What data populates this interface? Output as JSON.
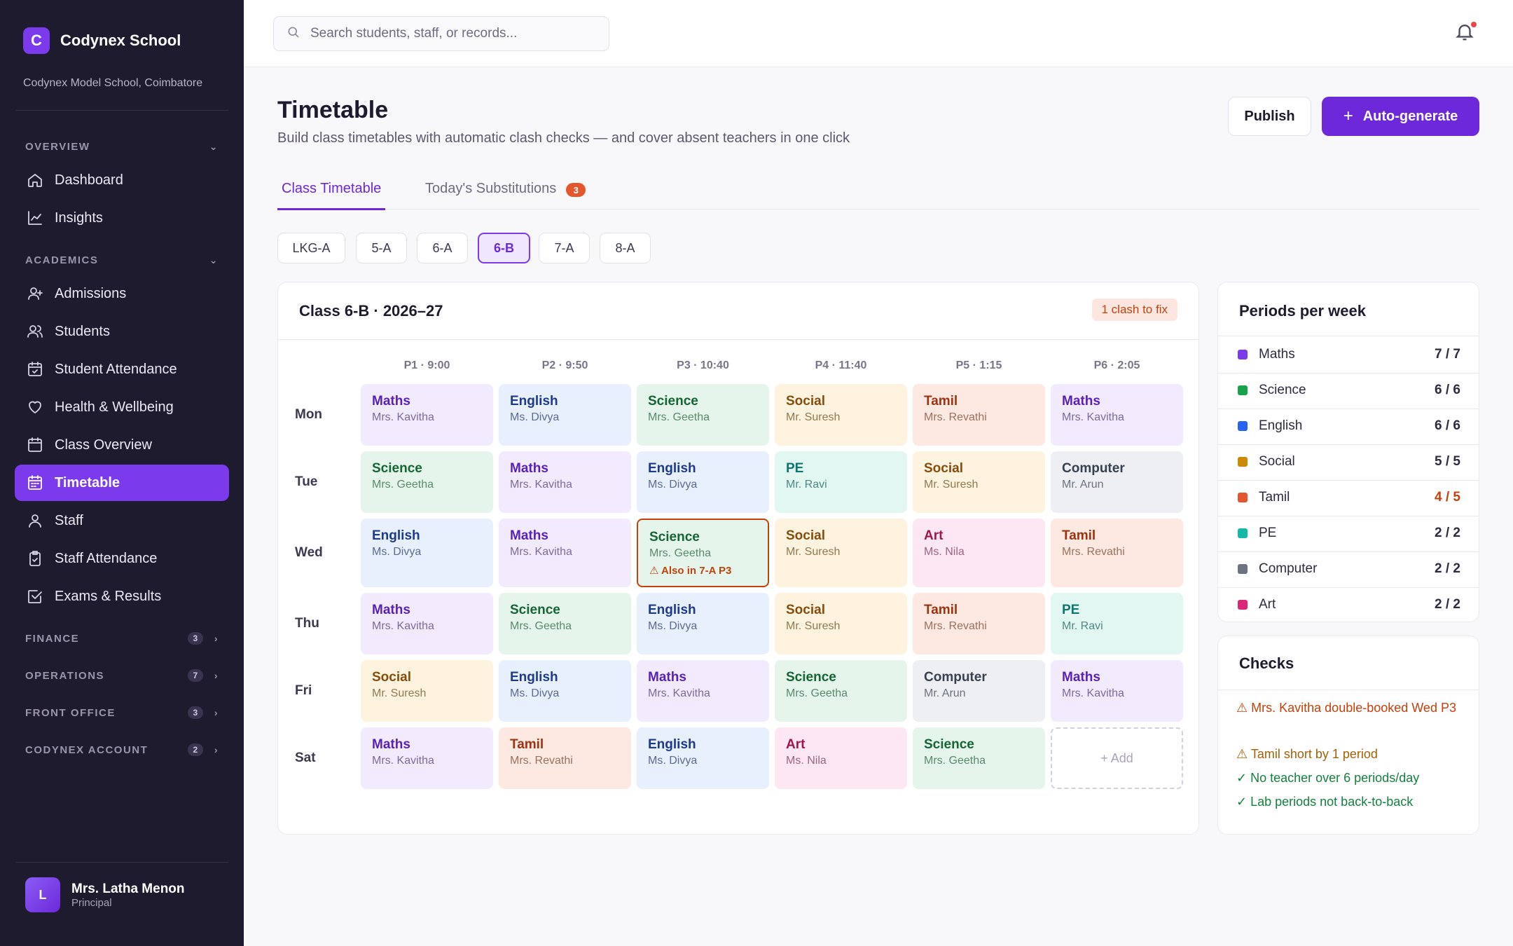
{
  "brand": {
    "logo_letter": "C",
    "name": "Codynex School",
    "school": "Codynex Model School, Coimbatore"
  },
  "sidebar": {
    "overview": {
      "label": "OVERVIEW",
      "items": [
        {
          "label": "Dashboard",
          "icon": "home-icon"
        },
        {
          "label": "Insights",
          "icon": "chart-line-icon"
        }
      ]
    },
    "academics": {
      "label": "ACADEMICS",
      "items": [
        {
          "label": "Admissions",
          "icon": "user-plus-icon"
        },
        {
          "label": "Students",
          "icon": "users-icon"
        },
        {
          "label": "Student Attendance",
          "icon": "calendar-check-icon"
        },
        {
          "label": "Health & Wellbeing",
          "icon": "heart-icon"
        },
        {
          "label": "Class Overview",
          "icon": "calendar-icon"
        },
        {
          "label": "Timetable",
          "icon": "calendar-grid-icon",
          "active": true
        },
        {
          "label": "Staff",
          "icon": "user-icon"
        },
        {
          "label": "Staff Attendance",
          "icon": "clipboard-check-icon"
        },
        {
          "label": "Exams & Results",
          "icon": "checkbox-icon"
        }
      ]
    },
    "collapsed": [
      {
        "label": "FINANCE",
        "count": "3"
      },
      {
        "label": "OPERATIONS",
        "count": "7"
      },
      {
        "label": "FRONT OFFICE",
        "count": "3"
      },
      {
        "label": "CODYNEX ACCOUNT",
        "count": "2"
      }
    ],
    "user": {
      "initial": "L",
      "name": "Mrs. Latha Menon",
      "role": "Principal"
    }
  },
  "topbar": {
    "search_placeholder": "Search students, staff, or records..."
  },
  "header": {
    "title": "Timetable",
    "subtitle": "Build class timetables with automatic clash checks — and cover absent teachers in one click",
    "publish_label": "Publish",
    "auto_label": "Auto-generate"
  },
  "tabs": [
    {
      "label": "Class Timetable",
      "active": true
    },
    {
      "label": "Today's Substitutions",
      "badge": "3"
    }
  ],
  "classes": [
    {
      "label": "LKG-A"
    },
    {
      "label": "5-A"
    },
    {
      "label": "6-A"
    },
    {
      "label": "6-B",
      "active": true
    },
    {
      "label": "7-A"
    },
    {
      "label": "8-A"
    }
  ],
  "timetable": {
    "title": "Class 6-B · 2026–27",
    "clash_label": "1 clash to fix",
    "periods": [
      "P1 · 9:00",
      "P2 · 9:50",
      "P3 · 10:40",
      "P4 · 11:40",
      "P5 · 1:15",
      "P6 · 2:05"
    ],
    "days": [
      {
        "day": "Mon",
        "cells": [
          {
            "subject": "Maths",
            "teacher": "Mrs. Kavitha"
          },
          {
            "subject": "English",
            "teacher": "Ms. Divya"
          },
          {
            "subject": "Science",
            "teacher": "Mrs. Geetha"
          },
          {
            "subject": "Social",
            "teacher": "Mr. Suresh"
          },
          {
            "subject": "Tamil",
            "teacher": "Mrs. Revathi"
          },
          {
            "subject": "Maths",
            "teacher": "Mrs. Kavitha"
          }
        ]
      },
      {
        "day": "Tue",
        "cells": [
          {
            "subject": "Science",
            "teacher": "Mrs. Geetha"
          },
          {
            "subject": "Maths",
            "teacher": "Mrs. Kavitha"
          },
          {
            "subject": "English",
            "teacher": "Ms. Divya"
          },
          {
            "subject": "PE",
            "teacher": "Mr. Ravi"
          },
          {
            "subject": "Social",
            "teacher": "Mr. Suresh"
          },
          {
            "subject": "Computer",
            "teacher": "Mr. Arun"
          }
        ]
      },
      {
        "day": "Wed",
        "cells": [
          {
            "subject": "English",
            "teacher": "Ms. Divya"
          },
          {
            "subject": "Maths",
            "teacher": "Mrs. Kavitha"
          },
          {
            "subject": "Science",
            "teacher": "Mrs. Geetha",
            "warning": "⚠ Also in 7-A P3"
          },
          {
            "subject": "Social",
            "teacher": "Mr. Suresh"
          },
          {
            "subject": "Art",
            "teacher": "Ms. Nila"
          },
          {
            "subject": "Tamil",
            "teacher": "Mrs. Revathi"
          }
        ]
      },
      {
        "day": "Thu",
        "cells": [
          {
            "subject": "Maths",
            "teacher": "Mrs. Kavitha"
          },
          {
            "subject": "Science",
            "teacher": "Mrs. Geetha"
          },
          {
            "subject": "English",
            "teacher": "Ms. Divya"
          },
          {
            "subject": "Social",
            "teacher": "Mr. Suresh"
          },
          {
            "subject": "Tamil",
            "teacher": "Mrs. Revathi"
          },
          {
            "subject": "PE",
            "teacher": "Mr. Ravi"
          }
        ]
      },
      {
        "day": "Fri",
        "cells": [
          {
            "subject": "Social",
            "teacher": "Mr. Suresh"
          },
          {
            "subject": "English",
            "teacher": "Ms. Divya"
          },
          {
            "subject": "Maths",
            "teacher": "Mrs. Kavitha"
          },
          {
            "subject": "Science",
            "teacher": "Mrs. Geetha"
          },
          {
            "subject": "Computer",
            "teacher": "Mr. Arun"
          },
          {
            "subject": "Maths",
            "teacher": "Mrs. Kavitha"
          }
        ]
      },
      {
        "day": "Sat",
        "cells": [
          {
            "subject": "Maths",
            "teacher": "Mrs. Kavitha"
          },
          {
            "subject": "Tamil",
            "teacher": "Mrs. Revathi"
          },
          {
            "subject": "English",
            "teacher": "Ms. Divya"
          },
          {
            "subject": "Art",
            "teacher": "Ms. Nila"
          },
          {
            "subject": "Science",
            "teacher": "Mrs. Geetha"
          },
          {
            "add": "+ Add"
          }
        ]
      }
    ]
  },
  "subject_colors": {
    "Maths": {
      "bg": "#f1ebfd",
      "fg": "#5b21b6",
      "sub": "#7c6a9c"
    },
    "English": {
      "bg": "#e8effd",
      "fg": "#1e3a8a",
      "sub": "#5a6b94"
    },
    "Science": {
      "bg": "#e6f5ec",
      "fg": "#166534",
      "sub": "#5b8a6b"
    },
    "Social": {
      "bg": "#fdf3df",
      "fg": "#854d0e",
      "sub": "#8f7a52"
    },
    "Tamil": {
      "bg": "#fde9e1",
      "fg": "#9a3412",
      "sub": "#9c705f"
    },
    "PE": {
      "bg": "#e2f6f2",
      "fg": "#0f766e",
      "sub": "#4f8a83"
    },
    "Computer": {
      "bg": "#eeeff2",
      "fg": "#374151",
      "sub": "#6b7280"
    },
    "Art": {
      "bg": "#fce7f3",
      "fg": "#9d174d",
      "sub": "#9a6482"
    }
  },
  "periods_per_week": {
    "title": "Periods per week",
    "rows": [
      {
        "subject": "Maths",
        "value": "7 / 7",
        "color": "#7c3aed"
      },
      {
        "subject": "Science",
        "value": "6 / 6",
        "color": "#16a34a"
      },
      {
        "subject": "English",
        "value": "6 / 6",
        "color": "#2563eb"
      },
      {
        "subject": "Social",
        "value": "5 / 5",
        "color": "#ca8a04"
      },
      {
        "subject": "Tamil",
        "value": "4 / 5",
        "color": "#e4572e",
        "short": true
      },
      {
        "subject": "PE",
        "value": "2 / 2",
        "color": "#14b8a6"
      },
      {
        "subject": "Computer",
        "value": "2 / 2",
        "color": "#6b7280"
      },
      {
        "subject": "Art",
        "value": "2 / 2",
        "color": "#db2777"
      }
    ]
  },
  "checks": {
    "title": "Checks",
    "items": [
      {
        "text": "⚠ Mrs. Kavitha double-booked Wed P3",
        "color": "#c2410c"
      },
      {
        "text": "⚠ Tamil short by 1 period",
        "color": "#a16207"
      },
      {
        "text": "✓ No teacher over 6 periods/day",
        "color": "#15803d"
      },
      {
        "text": "✓ Lab periods not back-to-back",
        "color": "#15803d"
      }
    ]
  }
}
